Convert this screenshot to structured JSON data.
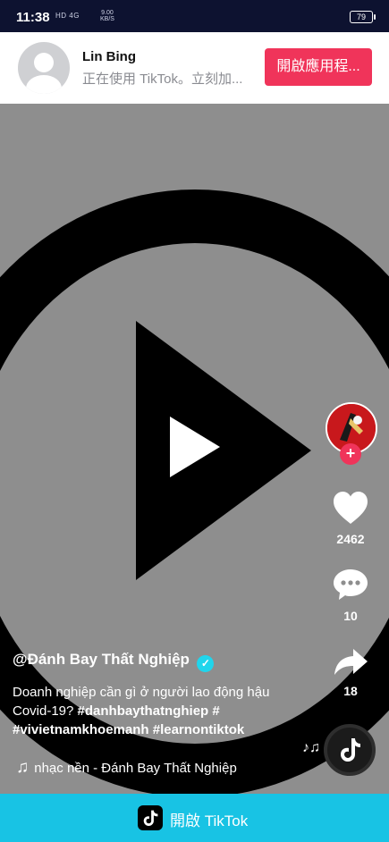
{
  "status_bar": {
    "time": "11:38",
    "signal_text": "HD 4G",
    "speed_value": "9.00",
    "speed_unit": "KB/S",
    "battery": "79"
  },
  "app_banner": {
    "user_name": "Lin Bing",
    "subtitle": "正在使用 TikTok。立刻加...",
    "open_app_label": "開啟應用程..."
  },
  "actions": {
    "likes": "2462",
    "comments": "10",
    "shares": "18",
    "follow_symbol": "+"
  },
  "caption": {
    "author": "@Đánh Bay Thất Nghiệp",
    "text": "Doanh nghiệp cần gì ở người lao động hậu Covid-19?",
    "hashtags": [
      "#danhbaythatnghiep",
      "#",
      "#vivietnamkhoemanh",
      "#learnontiktok"
    ]
  },
  "music": {
    "label": "nhạc nền - Đánh Bay Thất Nghiệp"
  },
  "bottom_bar": {
    "label": "開啟 TikTok"
  },
  "colors": {
    "accent": "#f0345a",
    "bottom_bar": "#18c3e4",
    "verified": "#20d5ec"
  }
}
